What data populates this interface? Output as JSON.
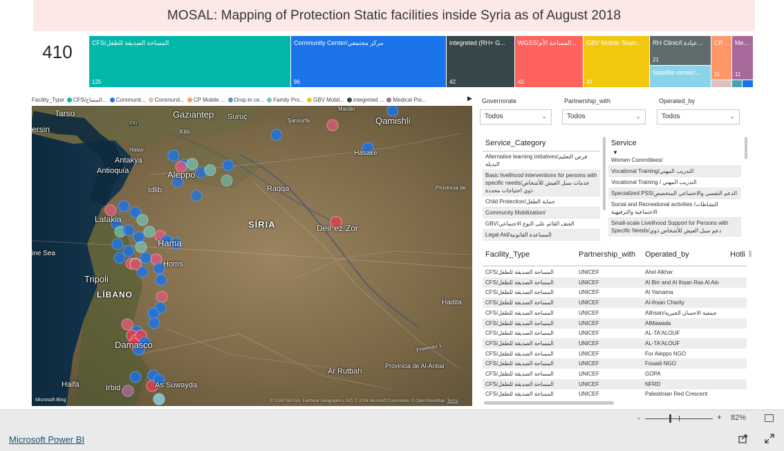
{
  "title": "MOSAL: Mapping of Protection Static facilities inside Syria as of August 2018",
  "kpi": "410",
  "treemap": [
    {
      "label": "CFS/المساحة الصديقة للطفل",
      "value": "125",
      "color": "#01b8aa"
    },
    {
      "label": "Community Center/مركز مجتمعي",
      "value": "96",
      "color": "#1a73e8"
    },
    {
      "label": "integreted (RH+ G...",
      "value": "42",
      "color": "#374649"
    },
    {
      "label": "WGSS/المساحة الآم...",
      "value": "42",
      "color": "#fd625e"
    },
    {
      "label": "GBV Mobile Team...",
      "value": "41",
      "color": "#f2c80f"
    },
    {
      "label": "RH Clinic/عيادة ا...",
      "value": "21",
      "color": "#5f6b6d"
    },
    {
      "label": "Satellite center/...",
      "value": "",
      "color": "#8ad4eb"
    },
    {
      "label": "CP ...",
      "value": "11",
      "color": "#fe9666"
    },
    {
      "label": "Me...",
      "value": "11",
      "color": "#a66999"
    }
  ],
  "legend": {
    "title": "Facility_Type",
    "items": [
      {
        "label": "CFS/المساح...",
        "color": "#01b8aa"
      },
      {
        "label": "Communit...",
        "color": "#1a73e8"
      },
      {
        "label": "Communit...",
        "color": "#dfbfbf"
      },
      {
        "label": "CP Mobile ...",
        "color": "#fe9666"
      },
      {
        "label": "Drop-in ce...",
        "color": "#4a9fb5"
      },
      {
        "label": "Family Pro...",
        "color": "#73c6b6"
      },
      {
        "label": "GBV Mobil...",
        "color": "#f2c80f"
      },
      {
        "label": "integreted ...",
        "color": "#374649"
      },
      {
        "label": "Medical Poi...",
        "color": "#a66999"
      }
    ],
    "more_icon": "next-arrow-icon"
  },
  "map": {
    "places": [
      "Tarso",
      "Gaziantep",
      "Suruç",
      "Mardin",
      "Qamishli",
      "ersin",
      "Hatay",
      "Antakya",
      "Antioquía",
      "Idlib",
      "Aleppo",
      "Hasake",
      "Raqqa",
      "Provincia de",
      "Latakia",
      "SÍRIA",
      "Deir ez-Zor",
      "Hama",
      "ine Sea",
      "Homs",
      "Tripoli",
      "LÍBANO",
      "Hadita",
      "Damasco",
      "Freeway 1",
      "Provincia de Al-Anbar",
      "Ar Rutbah",
      "Haifa",
      "Irbid",
      "As Suwayda",
      "Şanlıurfa",
      "Kilis",
      "E91"
    ],
    "attribution": "© 2024 TomTom, Earthstar Geographics SIO, © 2024 Microsoft Corporation, © OpenStreetMap",
    "terms": "Terms",
    "logo": "Microsoft Bing"
  },
  "slicers": [
    {
      "title": "Governorate",
      "value": "Todos"
    },
    {
      "title": "Partnership_with",
      "value": "Todos"
    },
    {
      "title": "Operated_by",
      "value": "Todos"
    }
  ],
  "service_category": {
    "title": "Service_Category",
    "items": [
      "Alternative learning initiatives/فرص التعليم البديلة",
      "Basic livelihood interventions for persons with specific needs/خدمات سبل العيش للأشخاص ذوي احتياجات محددة",
      "Child Protection/حماية الطفل",
      "Community Mobilization/",
      "GBV/العنف القائم على النوع الاجتماعي",
      "Legal Aid/المساعدة القانونية"
    ]
  },
  "service": {
    "title": "Service",
    "items": [
      "Women Committees/",
      "Vocational Training/التدريب المهني",
      "Vocational Training / التدريب المهني",
      "Specialized PSS/الدعم النفسي والاجتماعي المتخصص",
      "Social and Recreational activities /النشاطات الاجتماعية والترفيهية",
      "Small-scale Livelihood Support for Persons with Specific Needs/دعم سبل العيش للأشخاص ذوي"
    ]
  },
  "table": {
    "columns": [
      "Facility_Type",
      "Partnership_with",
      "Operated_by",
      "Hotli"
    ],
    "rows": [
      [
        "CFS/المساحة الصديقة للطفل",
        "UNICEF",
        "Ahel Alkher"
      ],
      [
        "CFS/المساحة الصديقة للطفل",
        "UNICEF",
        "Al Birr and Al Ihsan Ras Al Ain"
      ],
      [
        "CFS/المساحة الصديقة للطفل",
        "UNICEF",
        "Al Yamama"
      ],
      [
        "CFS/المساحة الصديقة للطفل",
        "UNICEF",
        "Al-Ihsan Charity"
      ],
      [
        "CFS/المساحة الصديقة للطفل",
        "UNICEF",
        "Alihsan/جمعية الاحسان الخيرية"
      ],
      [
        "CFS/المساحة الصديقة للطفل",
        "UNICEF",
        "AlMawada"
      ],
      [
        "CFS/المساحة الصديقة للطفل",
        "UNICEF",
        "AL-TA'ALOUF"
      ],
      [
        "CFS/المساحة الصديقة للطفل",
        "UNICEF",
        "AL-TA'ALOUF"
      ],
      [
        "CFS/المساحة الصديقة للطفل",
        "UNICEF",
        "For Aleppo NGO"
      ],
      [
        "CFS/المساحة الصديقة للطفل",
        "UNICEF",
        "Fouadi NGO"
      ],
      [
        "CFS/المساحة الصديقة للطفل",
        "UNICEF",
        "GOPA"
      ],
      [
        "CFS/المساحة الصديقة للطفل",
        "UNICEF",
        "NFRD"
      ],
      [
        "CFS/المساحة الصديقة للطفل",
        "UNICEF",
        "Palestinian Red Crescent"
      ]
    ]
  },
  "zoom": {
    "minus": "-",
    "plus": "+",
    "value": "82%",
    "fit_icon": "fit-to-page-icon"
  },
  "footer": {
    "brand": "Microsoft Power BI",
    "share_icon": "share-icon",
    "expand_icon": "fullscreen-icon"
  }
}
